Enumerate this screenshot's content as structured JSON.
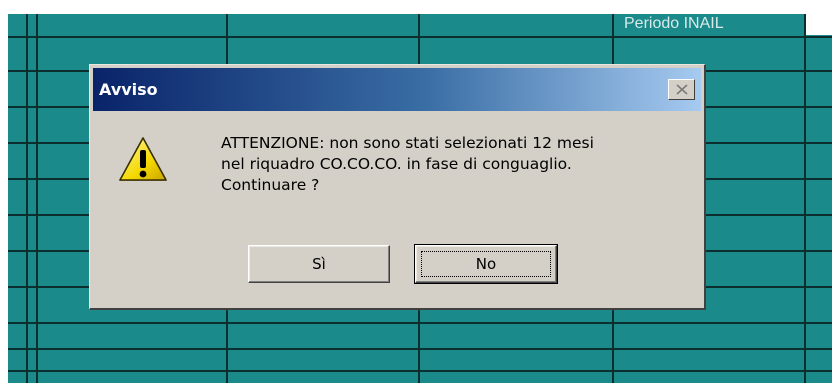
{
  "background_sheet": {
    "header_cell_text": "Periodo INAIL",
    "grid_color": "#1a8a8a",
    "grid_line_color": "#0b2f2f"
  },
  "dialog": {
    "title": "Avviso",
    "icon": "warning-icon",
    "message_lines": [
      "ATTENZIONE: non sono stati selezionati 12 mesi",
      "nel riquadro CO.CO.CO. in fase di conguaglio.",
      "Continuare ?"
    ],
    "buttons": {
      "yes_label": "Sì",
      "no_label": "No"
    },
    "close_icon": "close-icon",
    "colors": {
      "title_start": "#0a246a",
      "title_end": "#a6caf0",
      "face": "#d4d0c8"
    }
  }
}
